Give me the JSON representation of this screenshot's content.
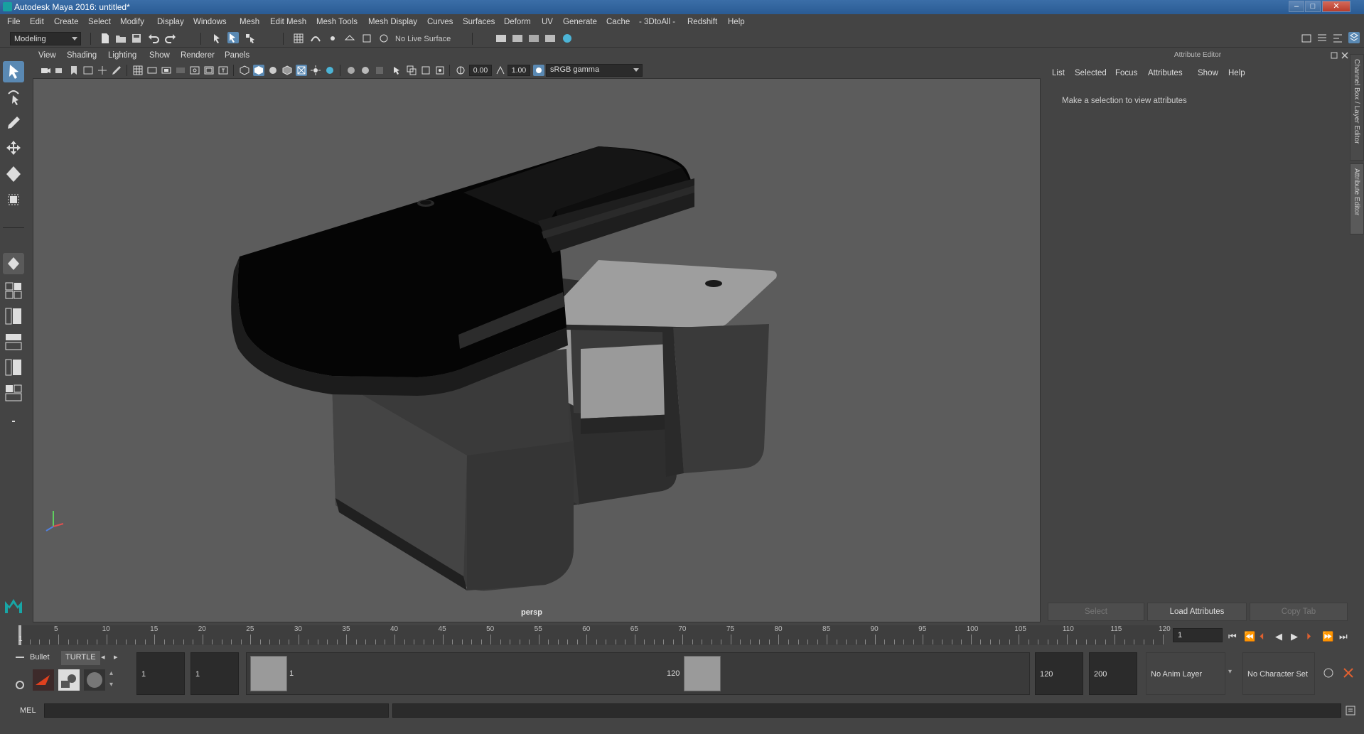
{
  "window": {
    "title": "Autodesk Maya 2016: untitled*"
  },
  "menubar": [
    "File",
    "Edit",
    "Create",
    "Select",
    "Modify",
    "Display",
    "Windows",
    "Mesh",
    "Edit Mesh",
    "Mesh Tools",
    "Mesh Display",
    "Curves",
    "Surfaces",
    "Deform",
    "UV",
    "Generate",
    "Cache",
    "- 3DtoAll -",
    "Redshift",
    "Help"
  ],
  "statusline": {
    "mode": "Modeling",
    "live_surface": "No Live Surface"
  },
  "panel": {
    "menu": [
      "View",
      "Shading",
      "Lighting",
      "Show",
      "Renderer",
      "Panels"
    ],
    "gamma_value_1": "0.00",
    "gamma_value_2": "1.00",
    "color_space": "sRGB gamma",
    "camera": "persp"
  },
  "attribute_editor": {
    "header": "Attribute Editor",
    "menu": [
      "List",
      "Selected",
      "Focus",
      "Attributes",
      "Show",
      "Help"
    ],
    "message": "Make a selection to view attributes",
    "buttons": {
      "select": "Select",
      "load": "Load Attributes",
      "copy": "Copy Tab"
    }
  },
  "side_tabs": {
    "channel_box": "Channel Box / Layer Editor",
    "attribute_editor": "Attribute Editor"
  },
  "timeline": {
    "ticks": [
      "5",
      "10",
      "15",
      "20",
      "25",
      "30",
      "35",
      "40",
      "45",
      "50",
      "55",
      "60",
      "65",
      "70",
      "75",
      "80",
      "85",
      "90",
      "95",
      "100",
      "105",
      "110",
      "115",
      "120"
    ],
    "start_marker": "1",
    "current_frame": "1"
  },
  "range": {
    "shelf_tabs": [
      "Bullet",
      "TURTLE"
    ],
    "start_field": "1",
    "start_field_2": "1",
    "range_start_label": "1",
    "range_end_label": "120",
    "end_field": "120",
    "end_field_2": "200",
    "anim_layer": "No Anim Layer",
    "character_set": "No Character Set"
  },
  "command_line": {
    "label": "MEL"
  },
  "colors": {
    "viewport_bg": "#5c5c5c",
    "ui_bg": "#444444",
    "accent": "#5a89b3"
  }
}
